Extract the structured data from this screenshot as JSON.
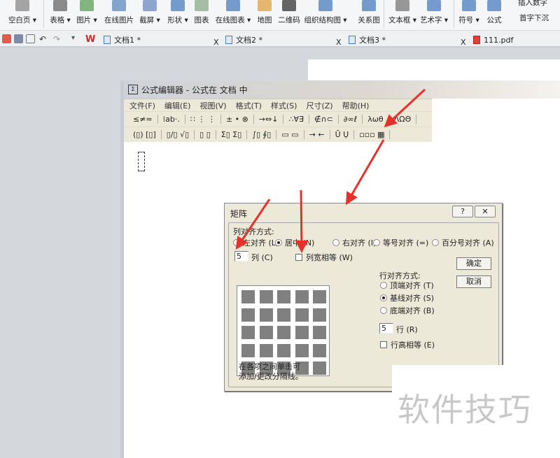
{
  "ribbon": {
    "items": [
      {
        "label": "空白页 ▾",
        "icon": "blank-page-icon"
      },
      {
        "label": "表格 ▾",
        "icon": "table-icon"
      },
      {
        "label": "图片 ▾",
        "icon": "picture-icon"
      },
      {
        "label": "在线图片",
        "icon": "online-picture-icon"
      },
      {
        "label": "截屏 ▾",
        "icon": "screenshot-icon"
      },
      {
        "label": "形状 ▾",
        "icon": "shape-icon"
      },
      {
        "label": "图表",
        "icon": "chart-icon"
      },
      {
        "label": "在线图表 ▾",
        "icon": "online-chart-icon"
      },
      {
        "label": "地图",
        "icon": "map-icon"
      },
      {
        "label": "二维码",
        "icon": "qrcode-icon"
      },
      {
        "label": "组织结构图 ▾",
        "icon": "org-chart-icon"
      },
      {
        "label": "关系图",
        "icon": "relation-icon"
      },
      {
        "label": "文本框 ▾",
        "icon": "textbox-icon"
      },
      {
        "label": "艺术字 ▾",
        "icon": "wordart-icon"
      },
      {
        "label": "符号 ▾",
        "icon": "omega-icon"
      },
      {
        "label": "公式",
        "icon": "pi-icon"
      }
    ],
    "small": [
      "插入数字",
      "首字下沉"
    ]
  },
  "tabs": [
    {
      "label": "文档1 *"
    },
    {
      "label": "文档2 *"
    },
    {
      "label": "文档3 *"
    },
    {
      "label": "111.pdf"
    }
  ],
  "close_glyph": "X",
  "eq": {
    "title": "公式编辑器 - 公式在 文档 中",
    "logo": "Σ",
    "menu": [
      "文件(F)",
      "编辑(E)",
      "视图(V)",
      "格式(T)",
      "样式(S)",
      "尺寸(Z)",
      "帮助(H)"
    ],
    "row1": [
      "≤≠≈",
      "⁞ab·.",
      "∷ ⋮ ⋮",
      "± • ⊗",
      "→⇔↓",
      "∴∀∃",
      "∉∩⊂",
      "∂∞ℓ",
      "λωθ",
      "ΛΩΘ"
    ],
    "row2": [
      "(▯) [▯]",
      "▯/▯ √▯",
      "▯ ▯",
      "Σ▯ Σ▯",
      "∫▯ ∮▯",
      "▭ ▭",
      "→ ←",
      "Ū Ụ",
      "▫▫▫ ▦"
    ]
  },
  "dialog": {
    "title": "矩阵",
    "help": "?",
    "close": "✕",
    "col_align_label": "列对齐方式:",
    "col_align": [
      {
        "label": "左对齐 (L)",
        "selected": false
      },
      {
        "label": "居中 (N)",
        "selected": true
      },
      {
        "label": "右对齐 (I)",
        "selected": false
      },
      {
        "label": "等号对齐 (=)",
        "selected": false
      },
      {
        "label": "百分号对齐 (A)",
        "selected": false
      }
    ],
    "cols_value": "5",
    "cols_label": "列 (C)",
    "equal_width": {
      "label": "列宽相等 (W)",
      "checked": false
    },
    "row_align_label": "行对齐方式:",
    "row_align": [
      {
        "label": "顶端对齐 (T)",
        "selected": false
      },
      {
        "label": "基线对齐 (S)",
        "selected": true
      },
      {
        "label": "底端对齐 (B)",
        "selected": false
      }
    ],
    "rows_value": "5",
    "rows_label": "行 (R)",
    "equal_height": {
      "label": "行高相等 (E)",
      "checked": false
    },
    "ok": "确定",
    "cancel": "取消",
    "hint1": "在各项之间单击可",
    "hint2": "添加/更改分隔线。"
  },
  "watermark": "软件技巧",
  "colors": {
    "arrow": "#e8302a",
    "cell": "#808080",
    "dialog": "#ece9d8"
  }
}
